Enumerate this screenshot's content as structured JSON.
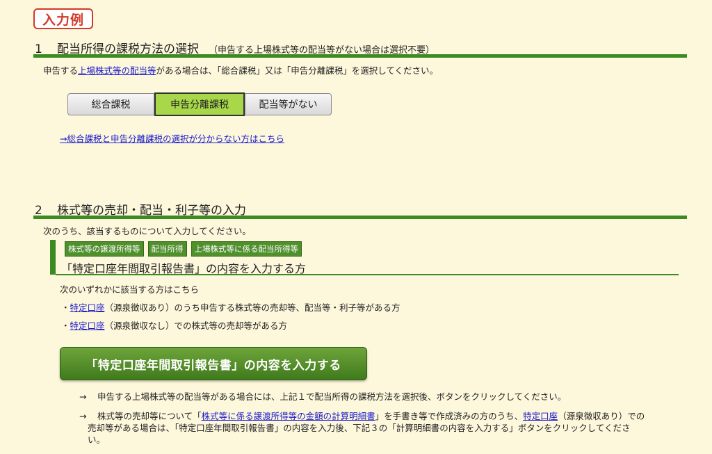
{
  "badge": "入力例",
  "section1": {
    "number": "1",
    "title": "配当所得の課税方法の選択",
    "note": "（申告する上場株式等の配当等がない場合は選択不要）",
    "desc_prefix": "申告する",
    "desc_link": "上場株式等の配当等",
    "desc_suffix": "がある場合は、「総合課税」又は「申告分離課税」を選択してください。",
    "options": [
      "総合課税",
      "申告分離課税",
      "配当等がない"
    ],
    "selected_option": "申告分離課税",
    "help_link": "→総合課税と申告分離課税の選択が分からない方はこちら"
  },
  "section2": {
    "number": "2",
    "title": "株式等の売却・配当・利子等の入力",
    "desc": "次のうち、該当するものについて入力してください。",
    "tags": [
      "株式等の譲渡所得等",
      "配当所得",
      "上場株式等に係る配当所得等"
    ],
    "sub_title": "「特定口座年間取引報告書」の内容を入力する方",
    "applies_intro": "次のいずれかに該当する方はこちら",
    "bullets": [
      {
        "prefix": "・",
        "link": "特定口座",
        "text": "（源泉徴収あり）のうち申告する株式等の売却等、配当等・利子等がある方"
      },
      {
        "prefix": "・",
        "link": "特定口座",
        "text": "（源泉徴収なし）での株式等の売却等がある方"
      }
    ],
    "button_label": "「特定口座年間取引報告書」の内容を入力する",
    "note1_arrow": "→",
    "note1": "申告する上場株式等の配当等がある場合には、上記１で配当所得の課税方法を選択後、ボタンをクリックしてください。",
    "note2_arrow": "→",
    "note2_a": "株式等の売却等について「",
    "note2_link1": "株式等に係る譲渡所得等の金額の計算明細書",
    "note2_b": "」を手書き等で作成済みの方のうち、",
    "note2_link2": "特定口座",
    "note2_c": "（源泉徴収あり）での",
    "note2_line2": "売却等がある場合は、「特定口座年間取引報告書」の内容を入力後、下記３の「計算明細書の内容を入力する」ボタンをクリックしてくださ",
    "note2_line3": "い。"
  }
}
